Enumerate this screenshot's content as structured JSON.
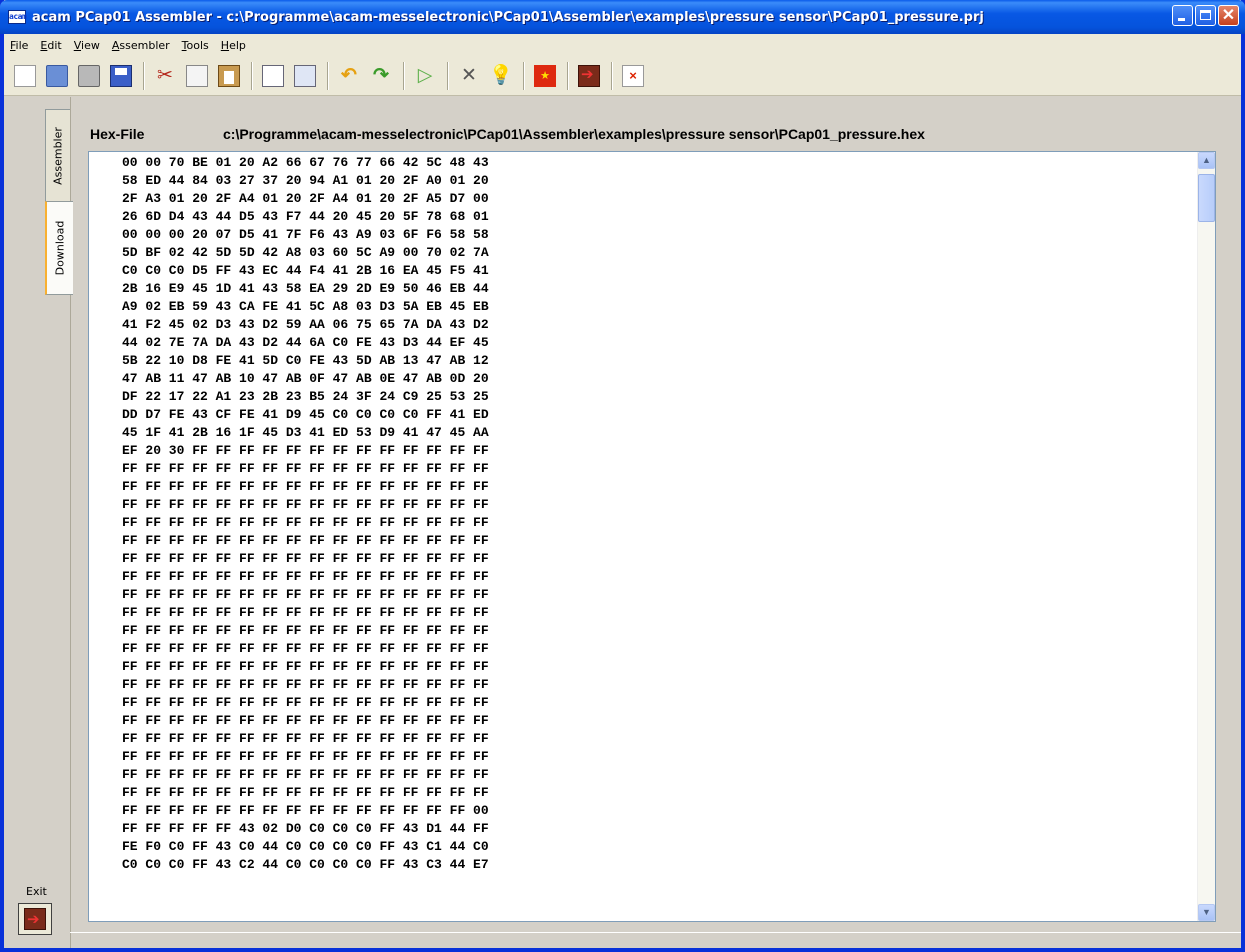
{
  "window": {
    "app_icon_text": "acam",
    "title": "acam PCap01 Assembler - c:\\Programme\\acam-messelectronic\\PCap01\\Assembler\\examples\\pressure sensor\\PCap01_pressure.prj",
    "buttons": {
      "minimize": "_",
      "maximize": "□",
      "close": "✕"
    }
  },
  "menu": [
    "File",
    "Edit",
    "View",
    "Assembler",
    "Tools",
    "Help"
  ],
  "toolbar": {
    "groups": [
      [
        "new-icon",
        "open-icon",
        "print-icon",
        "save-icon"
      ],
      [
        "cut-icon",
        "copy-icon",
        "paste-icon"
      ],
      [
        "print-preview-icon",
        "edit-icon"
      ],
      [
        "undo-icon",
        "redo-icon"
      ],
      [
        "run-icon"
      ],
      [
        "settings-icon",
        "hint-icon"
      ],
      [
        "language-flag-icon"
      ],
      [
        "exit-icon"
      ],
      [
        "close-icon"
      ]
    ]
  },
  "sidebar": {
    "tabs": [
      "Assembler",
      "Download"
    ],
    "exit_label": "Exit"
  },
  "hex": {
    "header_label": "Hex-File",
    "path": "c:\\Programme\\acam-messelectronic\\PCap01\\Assembler\\examples\\pressure sensor\\PCap01_pressure.hex",
    "lines": [
      "00 00 70 BE 01 20 A2 66 67 76 77 66 42 5C 48 43",
      "58 ED 44 84 03 27 37 20 94 A1 01 20 2F A0 01 20",
      "2F A3 01 20 2F A4 01 20 2F A4 01 20 2F A5 D7 00",
      "26 6D D4 43 44 D5 43 F7 44 20 45 20 5F 78 68 01",
      "00 00 00 20 07 D5 41 7F F6 43 A9 03 6F F6 58 58",
      "5D BF 02 42 5D 5D 42 A8 03 60 5C A9 00 70 02 7A",
      "C0 C0 C0 D5 FF 43 EC 44 F4 41 2B 16 EA 45 F5 41",
      "2B 16 E9 45 1D 41 43 58 EA 29 2D E9 50 46 EB 44",
      "A9 02 EB 59 43 CA FE 41 5C A8 03 D3 5A EB 45 EB",
      "41 F2 45 02 D3 43 D2 59 AA 06 75 65 7A DA 43 D2",
      "44 02 7E 7A DA 43 D2 44 6A C0 FE 43 D3 44 EF 45",
      "5B 22 10 D8 FE 41 5D C0 FE 43 5D AB 13 47 AB 12",
      "47 AB 11 47 AB 10 47 AB 0F 47 AB 0E 47 AB 0D 20",
      "DF 22 17 22 A1 23 2B 23 B5 24 3F 24 C9 25 53 25",
      "DD D7 FE 43 CF FE 41 D9 45 C0 C0 C0 C0 FF 41 ED",
      "45 1F 41 2B 16 1F 45 D3 41 ED 53 D9 41 47 45 AA",
      "EF 20 30 FF FF FF FF FF FF FF FF FF FF FF FF FF",
      "FF FF FF FF FF FF FF FF FF FF FF FF FF FF FF FF",
      "FF FF FF FF FF FF FF FF FF FF FF FF FF FF FF FF",
      "FF FF FF FF FF FF FF FF FF FF FF FF FF FF FF FF",
      "FF FF FF FF FF FF FF FF FF FF FF FF FF FF FF FF",
      "FF FF FF FF FF FF FF FF FF FF FF FF FF FF FF FF",
      "FF FF FF FF FF FF FF FF FF FF FF FF FF FF FF FF",
      "FF FF FF FF FF FF FF FF FF FF FF FF FF FF FF FF",
      "FF FF FF FF FF FF FF FF FF FF FF FF FF FF FF FF",
      "FF FF FF FF FF FF FF FF FF FF FF FF FF FF FF FF",
      "FF FF FF FF FF FF FF FF FF FF FF FF FF FF FF FF",
      "FF FF FF FF FF FF FF FF FF FF FF FF FF FF FF FF",
      "FF FF FF FF FF FF FF FF FF FF FF FF FF FF FF FF",
      "FF FF FF FF FF FF FF FF FF FF FF FF FF FF FF FF",
      "FF FF FF FF FF FF FF FF FF FF FF FF FF FF FF FF",
      "FF FF FF FF FF FF FF FF FF FF FF FF FF FF FF FF",
      "FF FF FF FF FF FF FF FF FF FF FF FF FF FF FF FF",
      "FF FF FF FF FF FF FF FF FF FF FF FF FF FF FF FF",
      "FF FF FF FF FF FF FF FF FF FF FF FF FF FF FF FF",
      "FF FF FF FF FF FF FF FF FF FF FF FF FF FF FF FF",
      "FF FF FF FF FF FF FF FF FF FF FF FF FF FF FF 00",
      "FF FF FF FF FF 43 02 D0 C0 C0 C0 FF 43 D1 44 FF",
      "FE F0 C0 FF 43 C0 44 C0 C0 C0 C0 FF 43 C1 44 C0",
      "C0 C0 C0 FF 43 C2 44 C0 C0 C0 C0 FF 43 C3 44 E7"
    ]
  },
  "scrollbar": {
    "position_fraction": 0.03
  },
  "colors": {
    "title_blue": "#0858e5",
    "frame_blue": "#0831d9",
    "face": "#d4d0c8",
    "panel_bg": "#ffffff"
  }
}
